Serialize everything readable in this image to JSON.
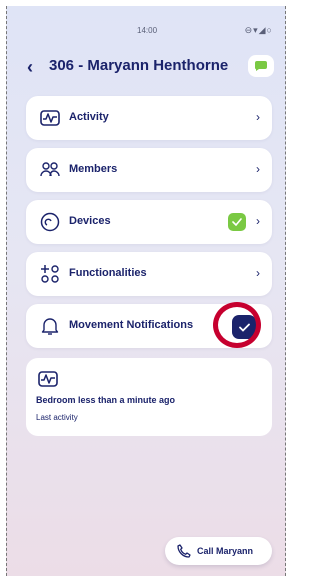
{
  "status_bar": {
    "time": "14:00",
    "icons": "⊖▾◢○"
  },
  "header": {
    "title": "306 - Maryann Henthorne"
  },
  "menu": [
    {
      "label": "Activity"
    },
    {
      "label": "Members"
    },
    {
      "label": "Devices"
    },
    {
      "label": "Functionalities"
    }
  ],
  "notifications": {
    "label": "Movement Notifications",
    "checked": true
  },
  "activity": {
    "main": "Bedroom less than a minute ago",
    "sub": "Last activity"
  },
  "call": {
    "label": "Call Maryann"
  },
  "colors": {
    "primary": "#1b236b",
    "green": "#7ac943",
    "highlight": "#c6002f"
  }
}
